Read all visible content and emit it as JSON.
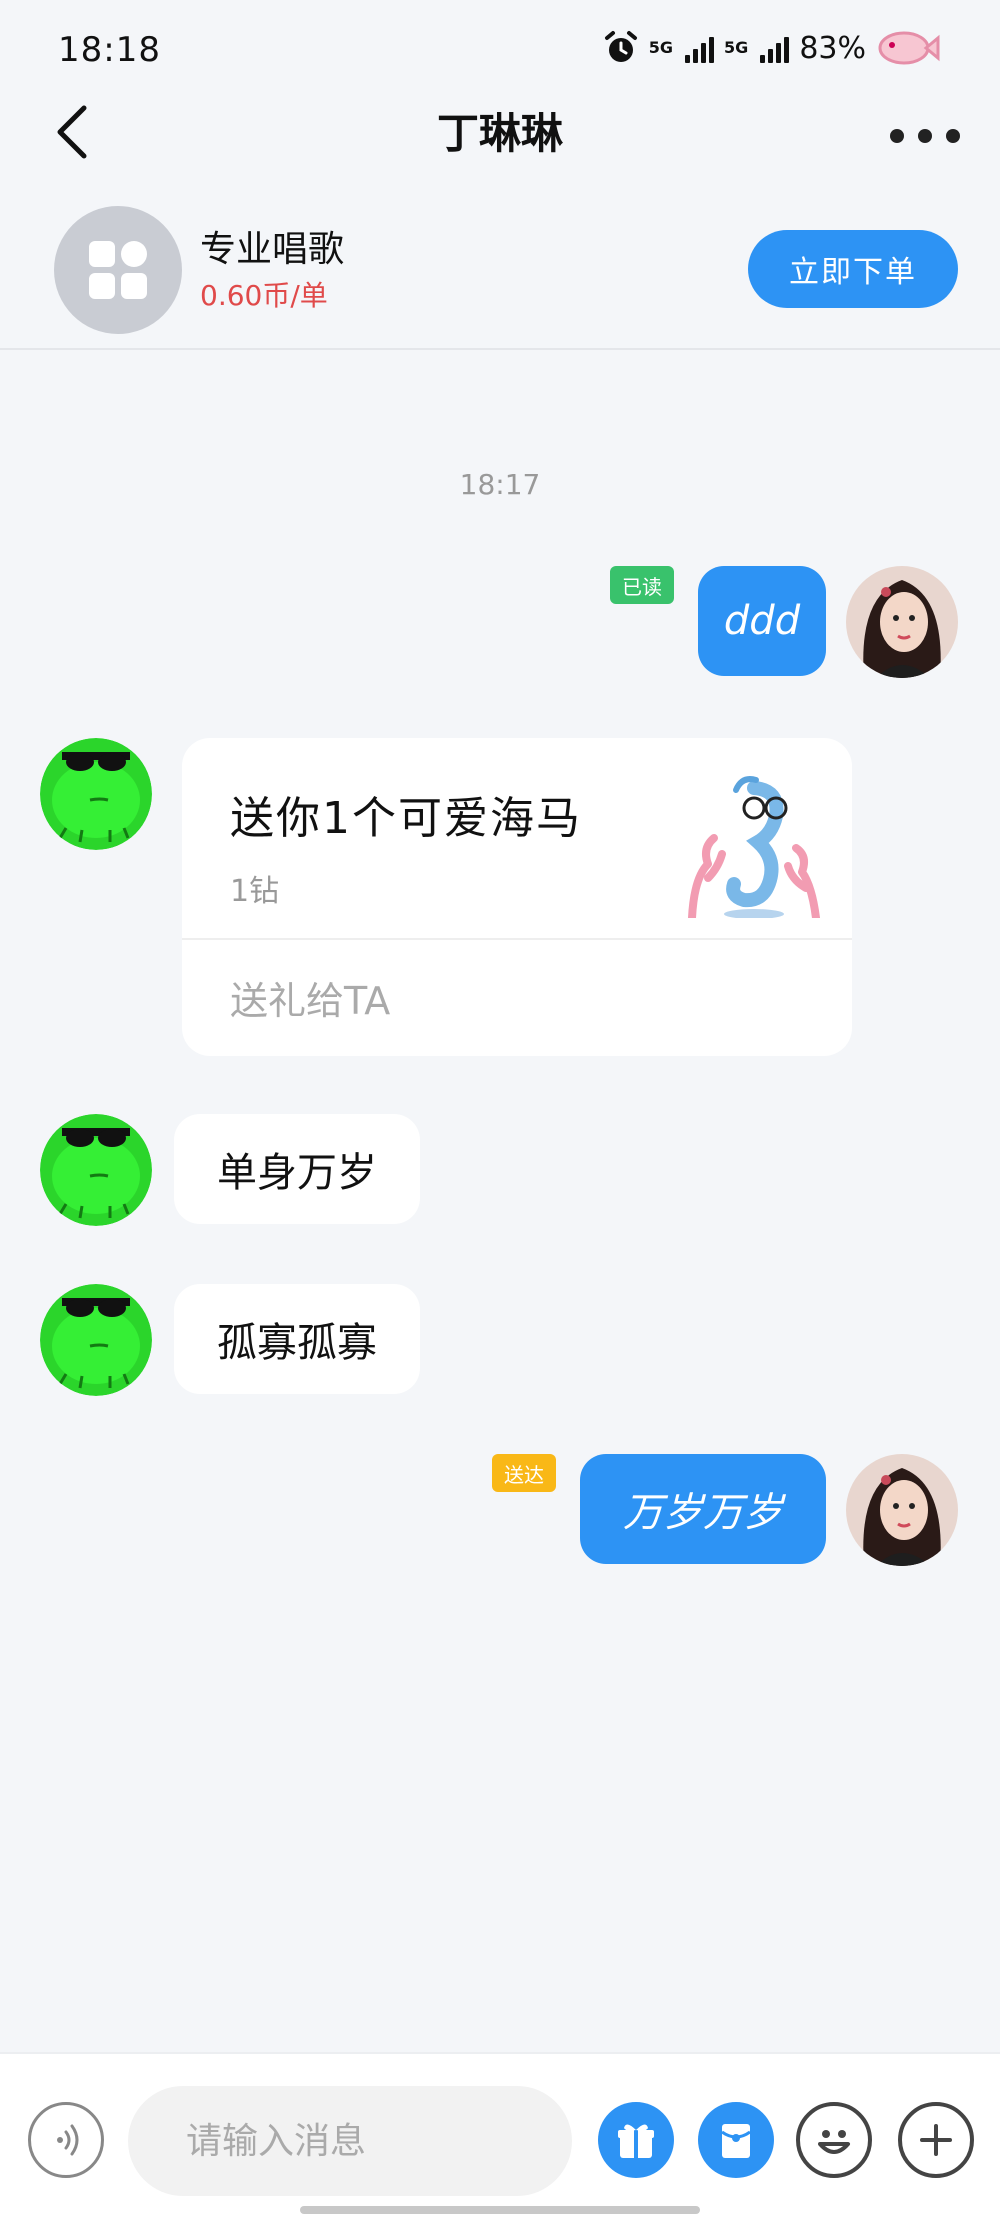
{
  "status_bar": {
    "time": "18:18",
    "net1": "5G",
    "net2": "5G",
    "battery": "83%"
  },
  "header": {
    "title": "丁琳琳"
  },
  "service": {
    "name": "专业唱歌",
    "price": "0.60币/单",
    "order_label": "立即下单"
  },
  "chat": {
    "timestamp": "18:17",
    "messages": [
      {
        "from": "me",
        "text": "ddd",
        "tag": "已读",
        "tag_color": "#39c26c"
      },
      {
        "from": "other",
        "type": "gift",
        "title": "送你1个可爱海马",
        "price": "1钻",
        "action": "送礼给TA"
      },
      {
        "from": "other",
        "text": "单身万岁"
      },
      {
        "from": "other",
        "text": "孤寡孤寡"
      },
      {
        "from": "me",
        "text": "万岁万岁",
        "tag": "送达",
        "tag_color": "#f9b817"
      }
    ]
  },
  "input": {
    "placeholder": "请输入消息"
  },
  "colors": {
    "accent": "#2d93f4",
    "price_red": "#e04a4a",
    "read_green": "#39c26c",
    "delivered_yellow": "#f9b817"
  }
}
